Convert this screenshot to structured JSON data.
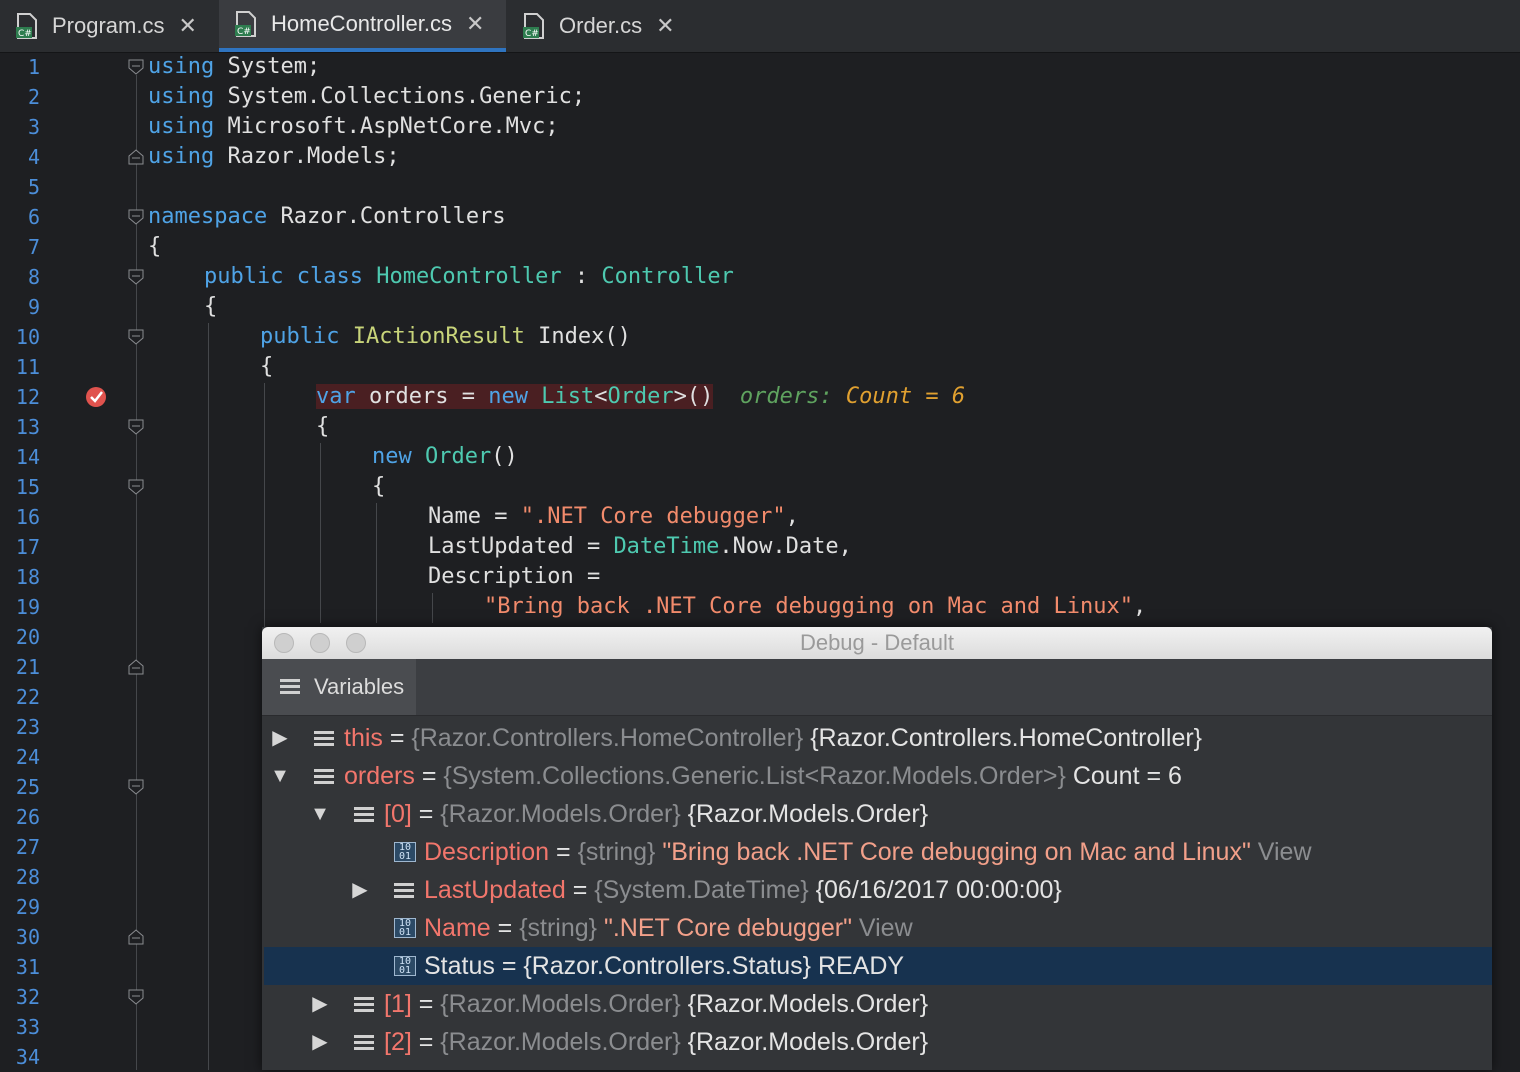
{
  "tabs": [
    {
      "label": "Program.cs",
      "active": false
    },
    {
      "label": "HomeController.cs",
      "active": true
    },
    {
      "label": "Order.cs",
      "active": false
    }
  ],
  "line_numbers": [
    "1",
    "2",
    "3",
    "4",
    "5",
    "6",
    "7",
    "8",
    "9",
    "10",
    "11",
    "12",
    "13",
    "14",
    "15",
    "16",
    "17",
    "18",
    "19",
    "20",
    "21",
    "22",
    "23",
    "24",
    "25",
    "26",
    "27",
    "28",
    "29",
    "30",
    "31",
    "32",
    "33",
    "34"
  ],
  "code": {
    "l1_kw": "using",
    "l1_rest": " System;",
    "l2_kw": "using",
    "l2_rest": " System.Collections.Generic;",
    "l3_kw": "using",
    "l3_rest": " Microsoft.AspNetCore.Mvc;",
    "l4_kw": "using",
    "l4_rest": " Razor.Models;",
    "l6_kw": "namespace",
    "l6_rest": " Razor.Controllers",
    "l7": "{",
    "l8_kw": "public class",
    "l8_type": "HomeController",
    "l8_sep": " : ",
    "l8_base": "Controller",
    "l9": "{",
    "l10_kw": "public",
    "l10_type": "IActionResult",
    "l10_rest": " Index()",
    "l11": "{",
    "l12_kw": "var",
    "l12_mid": " orders = ",
    "l12_new": "new",
    "l12_type": " List",
    "l12_lt": "<",
    "l12_ord": "Order",
    "l12_gt": ">()",
    "l12_inlay_name": "orders:",
    "l12_inlay_val": "Count = 6",
    "l13": "{",
    "l14_kw": "new",
    "l14_type": " Order",
    "l14_rest": "()",
    "l15": "{",
    "l16_pre": "Name = ",
    "l16_str": "\".NET Core debugger\"",
    "l16_post": ",",
    "l17_pre": "LastUpdated = ",
    "l17_type": "DateTime",
    "l17_rest": ".Now.Date,",
    "l18": "Description =",
    "l19_str": "\"Bring back .NET Core debugging on Mac and Linux\"",
    "l19_post": ","
  },
  "debug_window": {
    "title": "Debug - Default",
    "tab_label": "Variables",
    "rows": [
      {
        "name": "this",
        "eq": " = ",
        "type": "{Razor.Controllers.HomeController}",
        "value": " {Razor.Controllers.HomeController}"
      },
      {
        "name": "orders",
        "eq": " = ",
        "type": "{System.Collections.Generic.List<Razor.Models.Order>}",
        "value": " Count = 6"
      },
      {
        "name": "[0]",
        "eq": " = ",
        "type": "{Razor.Models.Order}",
        "value": " {Razor.Models.Order}"
      },
      {
        "name": "Description",
        "eq": " = ",
        "type": "{string}",
        "value": " \"Bring back .NET Core debugging on Mac and Linux\"",
        "link": " View"
      },
      {
        "name": "LastUpdated",
        "eq": " = ",
        "type": "{System.DateTime}",
        "value": " {06/16/2017 00:00:00}"
      },
      {
        "name": "Name",
        "eq": " = ",
        "type": "{string}",
        "value": " \".NET Core debugger\"",
        "link": " View"
      },
      {
        "name": "Status",
        "eq": " = ",
        "type": "{Razor.Controllers.Status}",
        "value": " READY"
      },
      {
        "name": "[1]",
        "eq": " = ",
        "type": "{Razor.Models.Order}",
        "value": " {Razor.Models.Order}"
      },
      {
        "name": "[2]",
        "eq": " = ",
        "type": "{Razor.Models.Order}",
        "value": " {Razor.Models.Order}"
      }
    ]
  },
  "colors": {
    "accent": "#2f74c0",
    "keyword": "#4fa3e6",
    "type": "#4ec9b0",
    "string": "#f28b6c",
    "variable_name": "#f2766c",
    "selected_row": "#17324f"
  }
}
